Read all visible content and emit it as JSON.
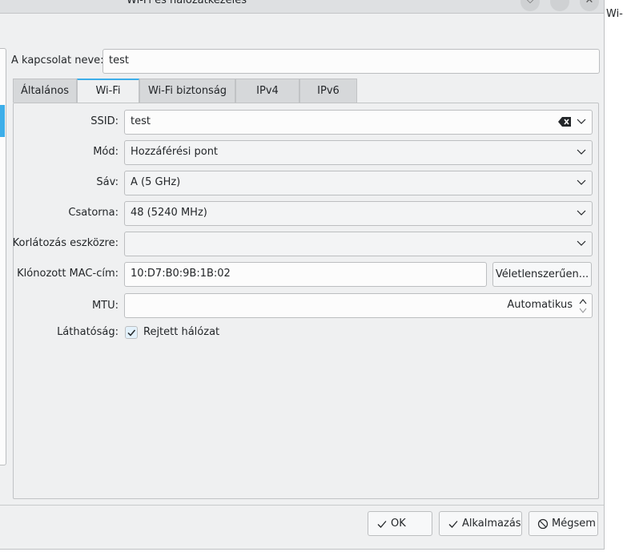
{
  "window": {
    "title": "Wi-Fi és hálózatkezelés",
    "behind_fragment": "Wi-F"
  },
  "connection": {
    "name_label": "A kapcsolat neve:",
    "name_value": "test"
  },
  "tabs": [
    {
      "label": "Általános",
      "active": false
    },
    {
      "label": "Wi-Fi",
      "active": true
    },
    {
      "label": "Wi-Fi biztonság",
      "active": false
    },
    {
      "label": "IPv4",
      "active": false
    },
    {
      "label": "IPv6",
      "active": false
    }
  ],
  "wifi": {
    "ssid_label": "SSID:",
    "ssid_value": "test",
    "mode_label": "Mód:",
    "mode_value": "Hozzáférési pont",
    "band_label": "Sáv:",
    "band_value": "A (5 GHz)",
    "channel_label": "Csatorna:",
    "channel_value": "48 (5240 MHz)",
    "restrict_label": "Korlátozás eszközre:",
    "restrict_value": "",
    "mac_label": "Klónozott MAC-cím:",
    "mac_value": "10:D7:B0:9B:1B:02",
    "random_button": "Véletlenszerűen...",
    "mtu_label": "MTU:",
    "mtu_value": "Automatikus",
    "visibility_label": "Láthatóság:",
    "hidden_network_label": "Rejtett hálózat",
    "hidden_network_checked": true
  },
  "footer": {
    "ok": "OK",
    "apply": "Alkalmazás",
    "cancel": "Mégsem"
  },
  "colors": {
    "accent": "#3daee9",
    "window_bg": "#eff0f1",
    "field_bg": "#fcfcfc"
  }
}
